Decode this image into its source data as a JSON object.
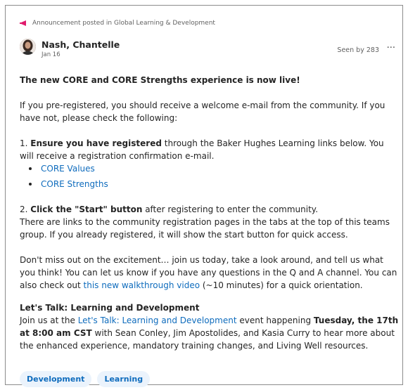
{
  "announcement": {
    "text": "Announcement posted in Global Learning & Development",
    "icon": "megaphone-icon",
    "accent_color": "#e01b6c"
  },
  "post": {
    "author": "Nash, Chantelle",
    "date": "Jan 16",
    "seen_by": "Seen by 283",
    "more": "···",
    "title": "The new CORE and CORE Strengths experience is now live!",
    "p1": "If you pre-registered, you should receive a welcome e-mail from the community. If you have not, please check the following:",
    "step1_num": "1. ",
    "step1_bold": "Ensure you have registered",
    "step1_rest": " through the Baker Hughes Learning links below. You will receive a registration confirmation e-mail.",
    "links": [
      "CORE Values",
      "CORE Strengths"
    ],
    "step2_num": "2. ",
    "step2_bold": "Click the \"Start\" button",
    "step2_rest": " after registering to enter the community.",
    "step2_line2": "There are links to the community registration pages in the tabs at the top of this teams group. If you already registered, it will show the start button for quick access.",
    "p3_a": "Don't miss out on the excitement… join us today, take a look around, and tell us what you think! You can let us know if you have any questions in the Q and A channel. You can also check out ",
    "p3_link": "this new walkthrough video",
    "p3_b": " (~10 minutes) for a quick orientation.",
    "lt_title": "Let's Talk: Learning and Development",
    "lt_a": "Join us at the ",
    "lt_link": "Let's Talk: Learning and Development",
    "lt_b": " event happening ",
    "lt_bold": "Tuesday, the 17th at 8:00 am CST",
    "lt_c": " with Sean Conley, Jim Apostolides, and Kasia Curry  to hear more about the enhanced experience, mandatory training changes, and Living Well resources."
  },
  "tags": [
    "Development",
    "Learning"
  ],
  "colors": {
    "link": "#0f6cbd",
    "tag_bg": "#ebf3fc",
    "text": "#242424",
    "muted": "#616161"
  }
}
